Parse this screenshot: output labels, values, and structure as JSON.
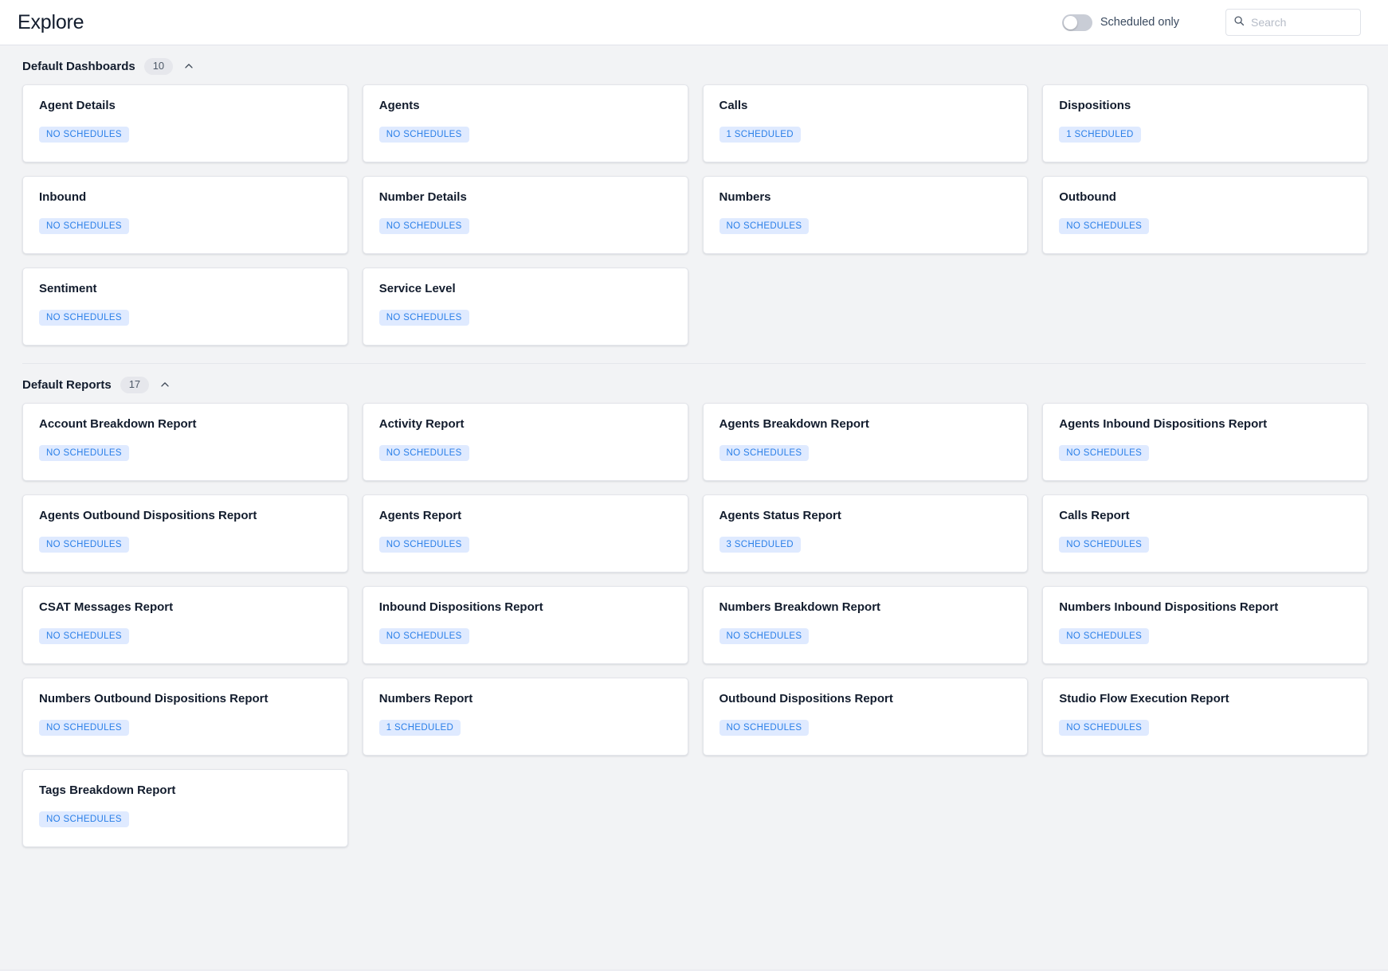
{
  "header": {
    "title": "Explore",
    "toggle": {
      "label": "Scheduled only",
      "state": "off",
      "name": "scheduled-only-toggle"
    },
    "search": {
      "placeholder": "Search",
      "value": "",
      "icon": "search-icon"
    }
  },
  "colors": {
    "page_background": "#f2f3f5",
    "card_background": "#ffffff",
    "badge_background": "#dfeaff",
    "badge_text": "#2a7fe8",
    "text_primary": "#121c2d",
    "pill_background": "#e6e7ec"
  },
  "sections": [
    {
      "id": "default-dashboards",
      "title": "Default Dashboards",
      "count": "10",
      "collapse_icon": "chevron-up-icon",
      "expanded": true,
      "cards": [
        {
          "title": "Agent Details",
          "badge": "NO SCHEDULES"
        },
        {
          "title": "Agents",
          "badge": "NO SCHEDULES"
        },
        {
          "title": "Calls",
          "badge": "1 SCHEDULED"
        },
        {
          "title": "Dispositions",
          "badge": "1 SCHEDULED"
        },
        {
          "title": "Inbound",
          "badge": "NO SCHEDULES"
        },
        {
          "title": "Number Details",
          "badge": "NO SCHEDULES"
        },
        {
          "title": "Numbers",
          "badge": "NO SCHEDULES"
        },
        {
          "title": "Outbound",
          "badge": "NO SCHEDULES"
        },
        {
          "title": "Sentiment",
          "badge": "NO SCHEDULES"
        },
        {
          "title": "Service Level",
          "badge": "NO SCHEDULES"
        }
      ]
    },
    {
      "id": "default-reports",
      "title": "Default Reports",
      "count": "17",
      "collapse_icon": "chevron-up-icon",
      "expanded": true,
      "cards": [
        {
          "title": "Account Breakdown Report",
          "badge": "NO SCHEDULES"
        },
        {
          "title": "Activity Report",
          "badge": "NO SCHEDULES"
        },
        {
          "title": "Agents Breakdown Report",
          "badge": "NO SCHEDULES"
        },
        {
          "title": "Agents Inbound Dispositions Report",
          "badge": "NO SCHEDULES"
        },
        {
          "title": "Agents Outbound Dispositions Report",
          "badge": "NO SCHEDULES"
        },
        {
          "title": "Agents Report",
          "badge": "NO SCHEDULES"
        },
        {
          "title": "Agents Status Report",
          "badge": "3 SCHEDULED"
        },
        {
          "title": "Calls Report",
          "badge": "NO SCHEDULES"
        },
        {
          "title": "CSAT Messages Report",
          "badge": "NO SCHEDULES"
        },
        {
          "title": "Inbound Dispositions Report",
          "badge": "NO SCHEDULES"
        },
        {
          "title": "Numbers Breakdown Report",
          "badge": "NO SCHEDULES"
        },
        {
          "title": "Numbers Inbound Dispositions Report",
          "badge": "NO SCHEDULES"
        },
        {
          "title": "Numbers Outbound Dispositions Report",
          "badge": "NO SCHEDULES"
        },
        {
          "title": "Numbers Report",
          "badge": "1 SCHEDULED"
        },
        {
          "title": "Outbound Dispositions Report",
          "badge": "NO SCHEDULES"
        },
        {
          "title": "Studio Flow Execution Report",
          "badge": "NO SCHEDULES"
        },
        {
          "title": "Tags Breakdown Report",
          "badge": "NO SCHEDULES"
        }
      ]
    }
  ]
}
